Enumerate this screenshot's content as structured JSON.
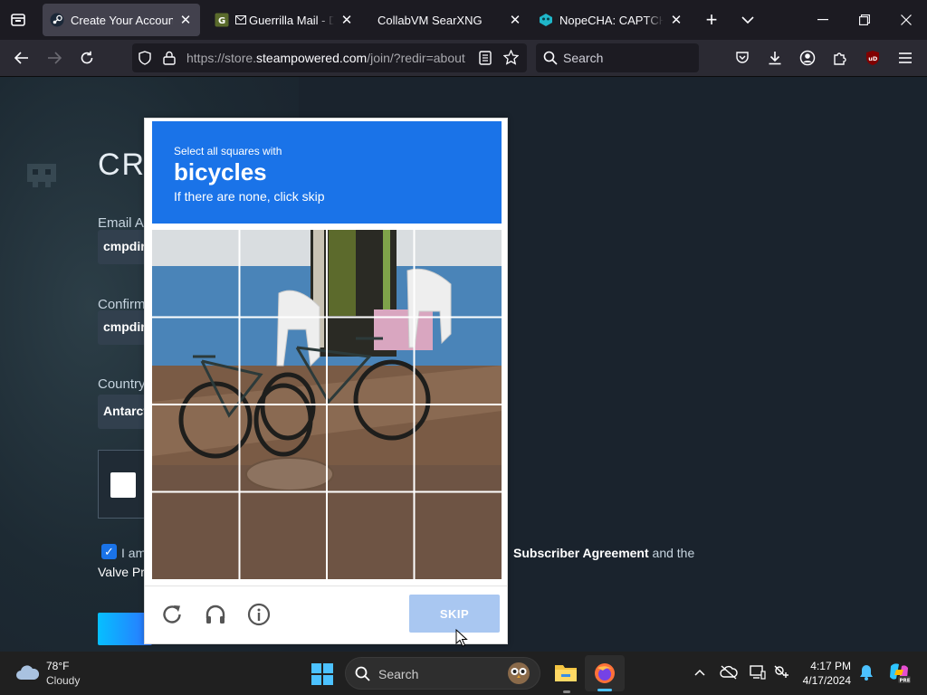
{
  "browser": {
    "tabs": [
      {
        "title": "Create Your Account",
        "active": true
      },
      {
        "title": "Guerrilla Mail - Disposa",
        "active": false
      },
      {
        "title": "CollabVM SearXNG",
        "active": false
      },
      {
        "title": "NopeCHA: CAPTCHA Solv",
        "active": false
      }
    ],
    "url_prefix": "https://store.",
    "url_host": "steampowered.com",
    "url_path": "/join/?redir=about",
    "search_placeholder": "Search",
    "extension_badge": "uD"
  },
  "page": {
    "title": "CR",
    "email_label": "Email Ac",
    "email_value": "cmpdir",
    "confirm_label": "Confirm",
    "confirm_value": "cmpdir",
    "country_label": "Country",
    "country_value": "Antarct",
    "agree_start": "I am",
    "agree_link1": "Subscriber Agreement",
    "agree_and": "and the",
    "agree_link2": "Valve Pr"
  },
  "captcha": {
    "instruction_small": "Select all squares with",
    "target": "bicycles",
    "instruction_sub": "If there are none, click skip",
    "skip_label": "SKIP"
  },
  "taskbar": {
    "temperature": "78°F",
    "weather": "Cloudy",
    "search_placeholder": "Search",
    "time": "4:17 PM",
    "date": "4/17/2024"
  },
  "colors": {
    "captcha_header": "#1a73e8",
    "skip_disabled": "#a9c7f1",
    "steam_bg": "#1a232d"
  }
}
